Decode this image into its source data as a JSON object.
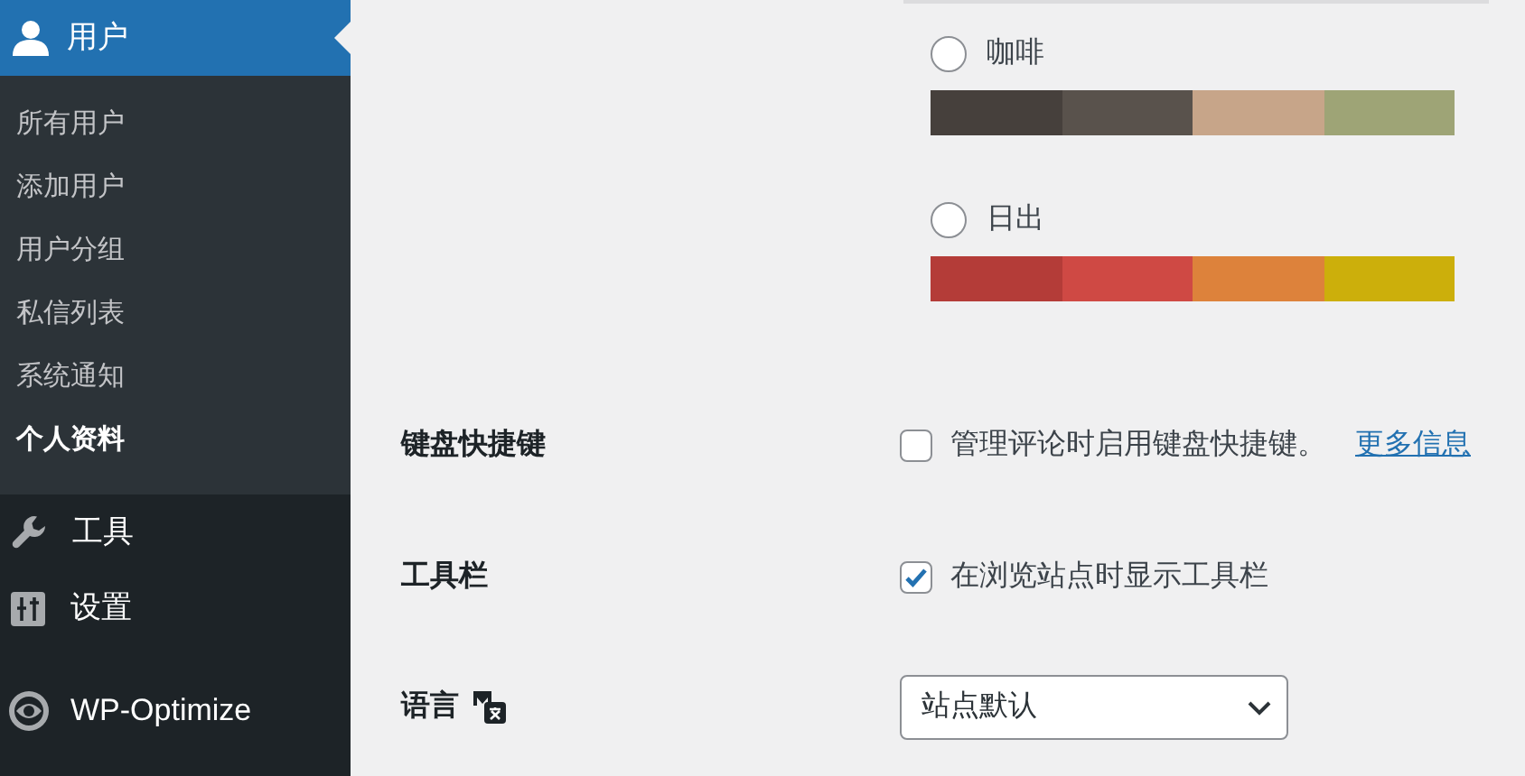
{
  "sidebar": {
    "current": {
      "label": "用户",
      "selected": true
    },
    "submenu": [
      {
        "label": "所有用户",
        "selected": false
      },
      {
        "label": "添加用户",
        "selected": false
      },
      {
        "label": "用户分组",
        "selected": false
      },
      {
        "label": "私信列表",
        "selected": false
      },
      {
        "label": "系统通知",
        "selected": false
      },
      {
        "label": "个人资料",
        "selected": true
      }
    ],
    "items": [
      {
        "kind": "wrench",
        "label": "工具"
      },
      {
        "kind": "sliders",
        "label": "设置"
      },
      {
        "kind": "eye",
        "label": "WP-Optimize"
      }
    ]
  },
  "color_schemes": [
    {
      "label": "咖啡",
      "selected": false,
      "swatches": [
        {
          "color": "#46403c"
        },
        {
          "color": "#59524c"
        },
        {
          "color": "#c7a589"
        },
        {
          "color": "#9ea476"
        }
      ]
    },
    {
      "label": "日出",
      "selected": false,
      "swatches": [
        {
          "color": "#b43c38"
        },
        {
          "color": "#cf4944"
        },
        {
          "color": "#dd823b"
        },
        {
          "color": "#ccaf0b"
        }
      ]
    }
  ],
  "settings": [
    {
      "kind": "checkbox",
      "label": "键盘快捷键",
      "checked": false,
      "text": "管理评论时启用键盘快捷键。",
      "link": "更多信息"
    },
    {
      "kind": "checkbox",
      "label": "工具栏",
      "checked": true,
      "text": "在浏览站点时显示工具栏"
    },
    {
      "kind": "select",
      "label": "语言",
      "value": "站点默认"
    }
  ]
}
